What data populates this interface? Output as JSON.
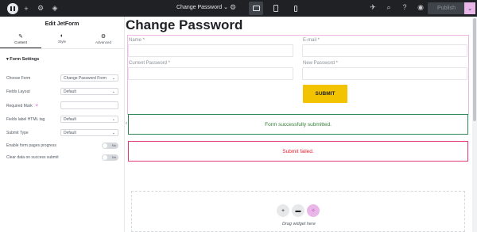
{
  "topbar": {
    "page_name": "Change Password",
    "publish_label": "Publish",
    "icons": [
      "elementor-logo",
      "add-icon",
      "sliders-icon",
      "layers-icon",
      "gear-icon",
      "desktop-icon",
      "tablet-icon",
      "mobile-icon",
      "rocket-icon",
      "search-icon",
      "help-icon",
      "eye-icon",
      "chevron-down-icon"
    ]
  },
  "panel": {
    "title": "Edit JetForm",
    "tabs": [
      {
        "label": "Content",
        "icon": "pencil-icon"
      },
      {
        "label": "Style",
        "icon": "half-circle-icon"
      },
      {
        "label": "Advanced",
        "icon": "gear-icon"
      }
    ],
    "section_title": "Form Settings",
    "rows": {
      "choose_form": {
        "label": "Choose Form",
        "value": "Change Password Form"
      },
      "fields_layout": {
        "label": "Fields Layout",
        "value": "Default"
      },
      "required_mark": {
        "label": "Required Mark",
        "value": ""
      },
      "fields_label_tag": {
        "label": "Fields label HTML tag",
        "value": "Default"
      },
      "submit_type": {
        "label": "Submit Type",
        "value": "Default"
      },
      "enable_progress": {
        "label": "Enable form pages progress",
        "toggle": "No"
      },
      "clear_data": {
        "label": "Clear data on success submit",
        "toggle": "No"
      }
    }
  },
  "canvas": {
    "heading": "Change Password",
    "form": {
      "name_label": "Name *",
      "email_label": "E-mail *",
      "current_password_label": "Current Password *",
      "new_password_label": "New Password *",
      "submit_label": "SUBMIT"
    },
    "success_message": "Form successfully submitted.",
    "fail_message": "Submit failed.",
    "drag_text": "Drag widget here"
  },
  "colors": {
    "topbar_bg": "#1f2124",
    "submit_bg": "#f2c300",
    "success_border": "#2e8b57",
    "fail_border": "#e23b7a",
    "accent_pink": "#e8b7e8"
  }
}
